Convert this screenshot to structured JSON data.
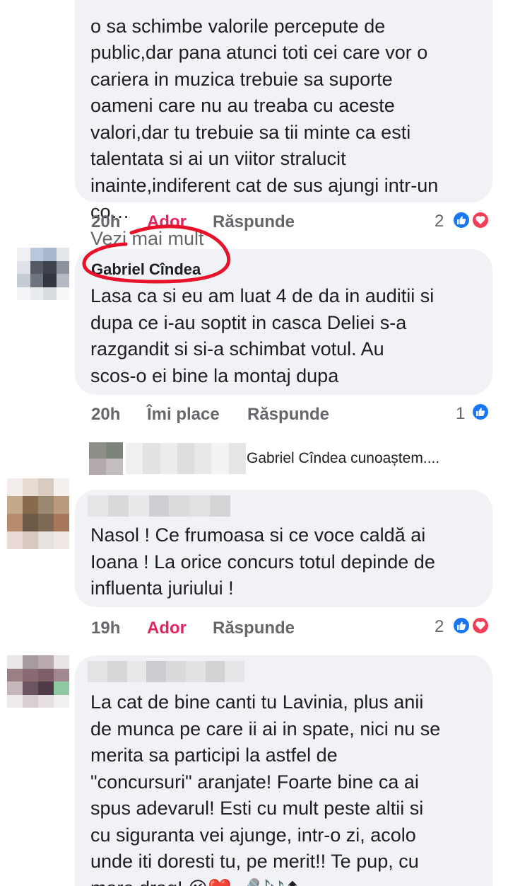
{
  "comments": [
    {
      "text": "o sa schimbe valorile percepute de\npublic,dar pana atunci toti cei care vor o\ncariera in muzica trebuie sa suporte\noameni care nu au treaba cu aceste\nvalori,dar tu trebuie sa tii minte ca esti\ntalentata si ai un viitor stralucit\ninainte,indiferent cat de sus ajungi intr-un\nco…",
      "see_more": "Vezi mai mult",
      "time": "20h",
      "like_label": "Ador",
      "reply_label": "Răspunde",
      "reaction_count": "2"
    },
    {
      "author": "Gabriel Cîndea",
      "text": "Lasa ca si eu am luat 4 de da in auditii si\ndupa ce i-au soptit in casca Deliei s-a\nrazgandit si si-a schimbat votul. Au\nscos-o ei bine la montaj dupa",
      "time": "20h",
      "like_label": "Îmi place",
      "reply_label": "Răspunde",
      "reaction_count": "1",
      "reply_preview": "Gabriel Cîndea cunoaștem...."
    },
    {
      "text": "Nasol ! Ce frumoasa si ce voce caldă ai\nIoana ! La orice concurs totul depinde de\ninfluenta juriului !",
      "time": "19h",
      "like_label": "Ador",
      "reply_label": "Răspunde",
      "reaction_count": "2"
    },
    {
      "text": "La cat de bine canti tu Lavinia, plus anii\nde munca pe care ii ai in spate, nici nu se\nmerita sa participi la astfel de\n\"concursuri\" aranjate! Foarte bine ca ai\nspus adevarul! Esti cu mult peste altii si\ncu siguranta vei ajunge, intr-o zi, acolo\nunde iti doresti tu, pe merit!! Te pup, cu\nmare drag!"
    }
  ],
  "colors": {
    "bubble": "#f0f2f5",
    "love_text": "#e0245e",
    "like_blue": "#1877f2",
    "love_red": "#f33e58",
    "annotation": "#e8122a"
  },
  "icons": [
    "like-reaction-icon",
    "love-reaction-icon",
    "red-circle-annotation"
  ]
}
